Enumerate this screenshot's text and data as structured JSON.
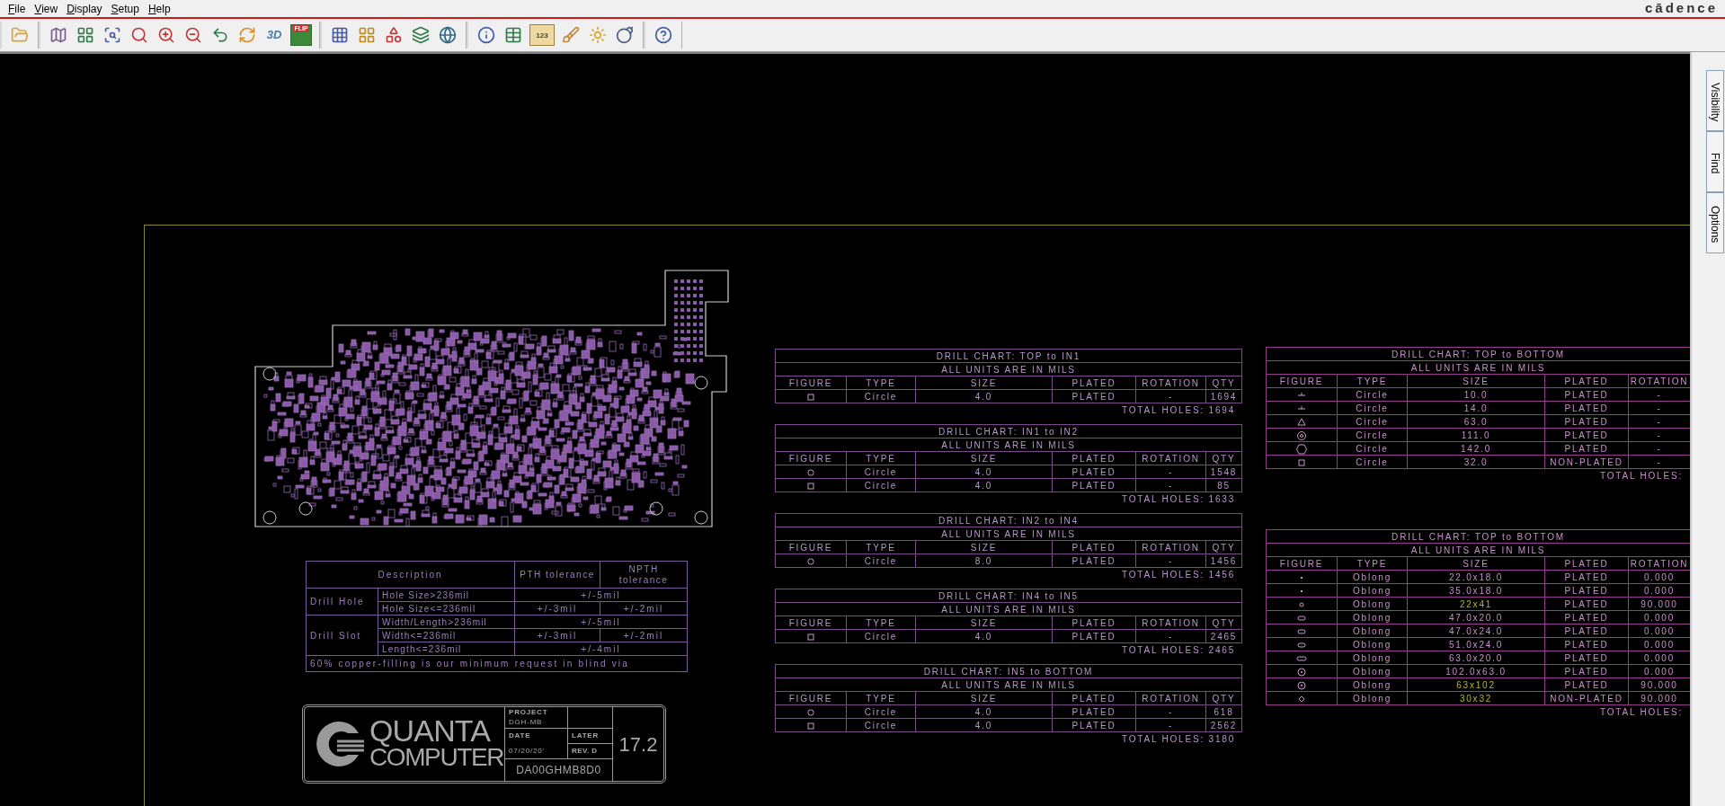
{
  "menu": [
    {
      "label": "File"
    },
    {
      "label": "View"
    },
    {
      "label": "Display"
    },
    {
      "label": "Setup"
    },
    {
      "label": "Help"
    }
  ],
  "brand": "cādence",
  "toolbar": [
    [
      {
        "kind": "folder"
      }
    ],
    [
      {
        "kind": "design"
      },
      {
        "kind": "grid-view"
      },
      {
        "kind": "zoom-fit"
      },
      {
        "kind": "zoom-box"
      },
      {
        "kind": "zoom-in"
      },
      {
        "kind": "zoom-out"
      },
      {
        "kind": "zoom-previous"
      },
      {
        "kind": "redraw"
      },
      {
        "kind": "text",
        "label": "3D"
      },
      {
        "kind": "flip",
        "label": "FLIP"
      }
    ],
    [
      {
        "kind": "grid"
      },
      {
        "kind": "color"
      },
      {
        "kind": "shapes"
      },
      {
        "kind": "layers"
      },
      {
        "kind": "world"
      }
    ],
    [
      {
        "kind": "info"
      },
      {
        "kind": "table"
      },
      {
        "kind": "ruler",
        "label": "123"
      },
      {
        "kind": "brush"
      },
      {
        "kind": "sun"
      },
      {
        "kind": "ball"
      }
    ],
    [
      {
        "kind": "help"
      }
    ]
  ],
  "side_tabs": [
    {
      "label": "Visibility"
    },
    {
      "label": "Find"
    },
    {
      "label": "Options"
    }
  ],
  "tolerance_table": {
    "header": [
      "Description",
      "PTH tolerance",
      "NPTH tolerance"
    ],
    "groups": [
      {
        "label": "Drill Hole",
        "rows": [
          {
            "condition": "Hole Size>236mil",
            "values": [
              "+/-5mil"
            ]
          },
          {
            "condition": "Hole Size<=236mil",
            "values": [
              "+/-3mil",
              "+/-2mil"
            ]
          }
        ]
      },
      {
        "label": "Drill Slot",
        "rows": [
          {
            "condition": "Width/Length>236mil",
            "values": [
              "+/-5mil"
            ]
          },
          {
            "condition": "Width<=236mil",
            "values": [
              "+/-3mil",
              "+/-2mil"
            ]
          },
          {
            "condition": "Length<=236mil",
            "values": [
              "+/-4mil"
            ]
          }
        ]
      }
    ],
    "note": "60% copper-filling is our minimum request in blind via"
  },
  "title_block": {
    "logo_top": "QUANTA",
    "logo_bottom": "COMPUTER",
    "project_label": "PROJECT",
    "project": "DGH-MB",
    "date_label": "DATE",
    "date": "07/20/20'",
    "status": "LATER",
    "revision": "REV. D",
    "part_number": "DA00GHMB8D0",
    "version": "17.2"
  },
  "drill_charts_center": [
    {
      "title": "DRILL CHART: TOP to IN1",
      "units": "ALL UNITS ARE IN MILS",
      "figure_header": "FIGURE",
      "columns": [
        "TYPE",
        "SIZE",
        "PLATED",
        "ROTATION",
        "QTY"
      ],
      "rows": [
        {
          "kind": "square",
          "cells": [
            "Circle",
            "4.0",
            "PLATED",
            "-",
            "1694"
          ]
        }
      ],
      "total": "TOTAL HOLES: 1694"
    },
    {
      "title": "DRILL CHART: IN1 to IN2",
      "units": "ALL UNITS ARE IN MILS",
      "figure_header": "FIGURE",
      "columns": [
        "TYPE",
        "SIZE",
        "PLATED",
        "ROTATION",
        "QTY"
      ],
      "rows": [
        {
          "kind": "round-square",
          "cells": [
            "Circle",
            "4.0",
            "PLATED",
            "-",
            "1548"
          ]
        },
        {
          "kind": "square",
          "cells": [
            "Circle",
            "4.0",
            "PLATED",
            "-",
            "85"
          ]
        }
      ],
      "total": "TOTAL HOLES: 1633"
    },
    {
      "title": "DRILL CHART: IN2 to IN4",
      "units": "ALL UNITS ARE IN MILS",
      "figure_header": "FIGURE",
      "columns": [
        "TYPE",
        "SIZE",
        "PLATED",
        "ROTATION",
        "QTY"
      ],
      "rows": [
        {
          "kind": "round-square",
          "cells": [
            "Circle",
            "8.0",
            "PLATED",
            "-",
            "1456"
          ]
        }
      ],
      "total": "TOTAL HOLES: 1456"
    },
    {
      "title": "DRILL CHART: IN4 to IN5",
      "units": "ALL UNITS ARE IN MILS",
      "figure_header": "FIGURE",
      "columns": [
        "TYPE",
        "SIZE",
        "PLATED",
        "ROTATION",
        "QTY"
      ],
      "rows": [
        {
          "kind": "square",
          "cells": [
            "Circle",
            "4.0",
            "PLATED",
            "-",
            "2465"
          ]
        }
      ],
      "total": "TOTAL HOLES: 2465"
    },
    {
      "title": "DRILL CHART: IN5 to BOTTOM",
      "units": "ALL UNITS ARE IN MILS",
      "figure_header": "FIGURE",
      "columns": [
        "TYPE",
        "SIZE",
        "PLATED",
        "ROTATION",
        "QTY"
      ],
      "rows": [
        {
          "kind": "round-square",
          "cells": [
            "Circle",
            "4.0",
            "PLATED",
            "-",
            "618"
          ]
        },
        {
          "kind": "square",
          "cells": [
            "Circle",
            "4.0",
            "PLATED",
            "-",
            "2562"
          ]
        }
      ],
      "total": "TOTAL HOLES: 3180"
    }
  ],
  "drill_charts_right": [
    {
      "title": "DRILL CHART: TOP to BOTTOM",
      "units": "ALL UNITS ARE IN MILS",
      "figure_header": "FIGURE",
      "columns": [
        "TYPE",
        "SIZE",
        "PLATED",
        "ROTATION"
      ],
      "rows": [
        {
          "kind": "tick",
          "cells": [
            "Circle",
            "10.0",
            "PLATED",
            "-"
          ]
        },
        {
          "kind": "tick",
          "cells": [
            "Circle",
            "14.0",
            "PLATED",
            "-"
          ]
        },
        {
          "kind": "triangle",
          "cells": [
            "Circle",
            "63.0",
            "PLATED",
            "-"
          ]
        },
        {
          "kind": "target",
          "cells": [
            "Circle",
            "111.0",
            "PLATED",
            "-"
          ]
        },
        {
          "kind": "hexagon",
          "cells": [
            "Circle",
            "142.0",
            "PLATED",
            "-"
          ]
        },
        {
          "kind": "square",
          "cells": [
            "Circle",
            "32.0",
            "NON-PLATED",
            "-"
          ]
        }
      ],
      "total": "TOTAL HOLES:"
    },
    {
      "title": "DRILL CHART: TOP to BOTTOM",
      "units": "ALL UNITS ARE IN MILS",
      "figure_header": "FIGURE",
      "columns": [
        "TYPE",
        "SIZE",
        "PLATED",
        "ROTATION"
      ],
      "rows": [
        {
          "kind": "dot",
          "size_highlighted": false,
          "cells": [
            "Oblong",
            "22.0x18.0",
            "PLATED",
            "0.000"
          ]
        },
        {
          "kind": "dot",
          "size_highlighted": false,
          "cells": [
            "Oblong",
            "35.0x18.0",
            "PLATED",
            "0.000"
          ]
        },
        {
          "kind": "small-circle",
          "size_highlighted": true,
          "cells": [
            "Oblong",
            "22x41",
            "PLATED",
            "90.000"
          ]
        },
        {
          "kind": "slot",
          "size_highlighted": false,
          "cells": [
            "Oblong",
            "47.0x20.0",
            "PLATED",
            "0.000"
          ]
        },
        {
          "kind": "slot",
          "size_highlighted": false,
          "cells": [
            "Oblong",
            "47.0x24.0",
            "PLATED",
            "0.000"
          ]
        },
        {
          "kind": "slot",
          "size_highlighted": false,
          "cells": [
            "Oblong",
            "51.0x24.0",
            "PLATED",
            "0.000"
          ]
        },
        {
          "kind": "wide-slot",
          "size_highlighted": false,
          "cells": [
            "Oblong",
            "63.0x20.0",
            "PLATED",
            "0.000"
          ]
        },
        {
          "kind": "ring",
          "size_highlighted": false,
          "cells": [
            "Oblong",
            "102.0x63.0",
            "PLATED",
            "0.000"
          ]
        },
        {
          "kind": "ring",
          "size_highlighted": true,
          "cells": [
            "Oblong",
            "63x102",
            "PLATED",
            "90.000"
          ]
        },
        {
          "kind": "diamond",
          "size_highlighted": true,
          "cells": [
            "Oblong",
            "30x32",
            "NON-PLATED",
            "90.000"
          ]
        }
      ],
      "total": "TOTAL HOLES:"
    }
  ]
}
